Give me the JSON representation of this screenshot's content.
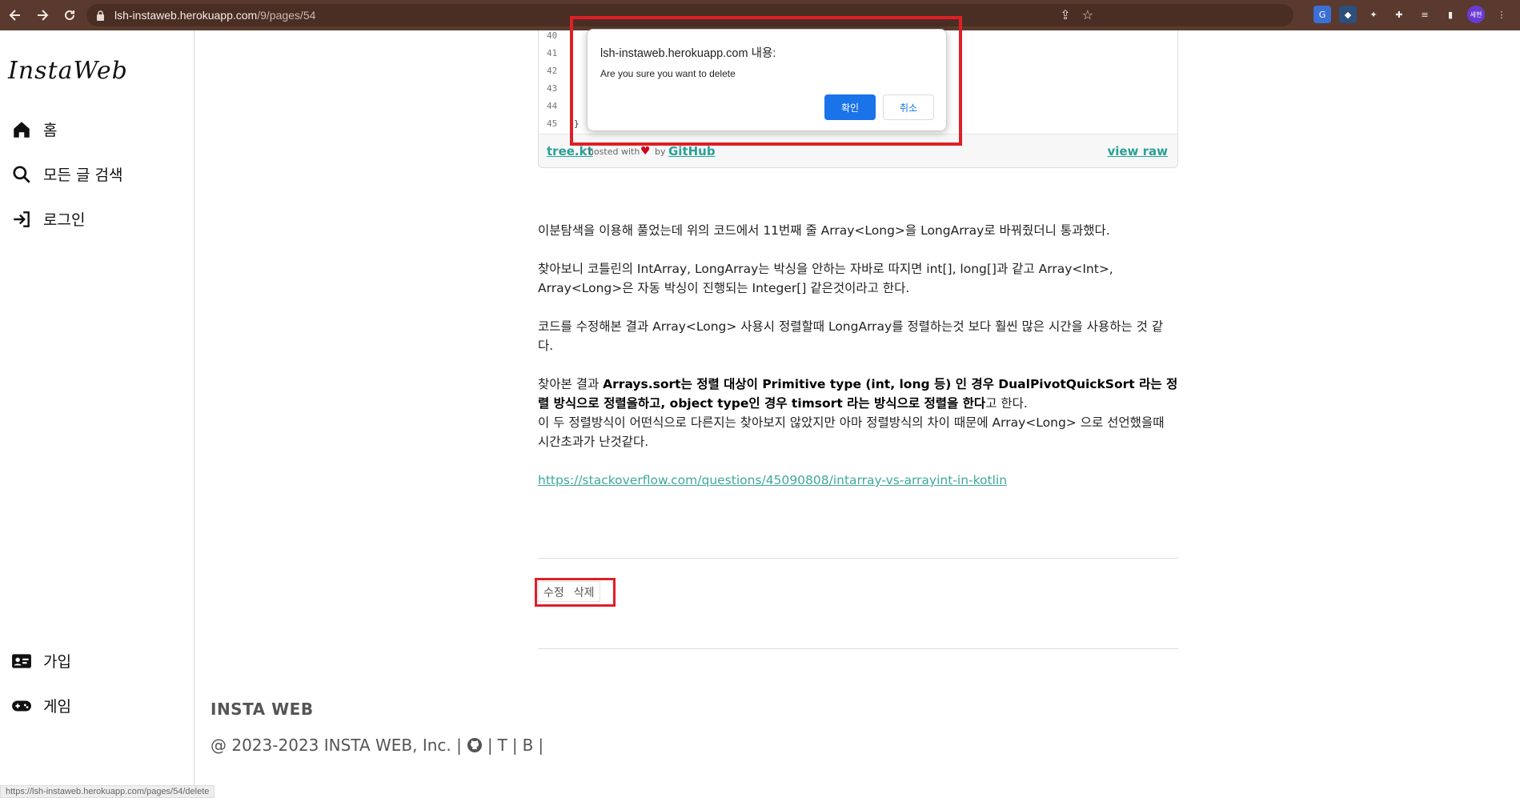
{
  "browser": {
    "url_host": "lsh-instaweb.herokuapp.com",
    "url_path": "/9/pages/54",
    "profile_label": "세현"
  },
  "sidebar": {
    "logo": "InstaWeb",
    "items": [
      {
        "label": "홈",
        "icon": "home-icon"
      },
      {
        "label": "모든 글 검색",
        "icon": "search-icon"
      },
      {
        "label": "로그인",
        "icon": "login-icon"
      },
      {
        "label": "가입",
        "icon": "id-card-icon"
      },
      {
        "label": "게임",
        "icon": "gamepad-icon"
      }
    ]
  },
  "gist": {
    "line_numbers": [
      "40",
      "41",
      "42",
      "43",
      "44",
      "45"
    ],
    "closing_brace": "}",
    "file_name": "tree.kt",
    "hosted_with": "hosted with",
    "by": "by",
    "github": "GitHub",
    "view_raw": "view raw"
  },
  "article": {
    "p1": "이분탐색을 이용해 풀었는데 위의 코드에서 11번째 줄  Array<Long>을 LongArray로 바꿔줬더니 통과했다.",
    "p2": "찾아보니 코틀린의 IntArray, LongArray는 박싱을 안하는 자바로 따지면 int[], long[]과 같고 Array<Int>, Array<Long>은 자동 박싱이 진행되는 Integer[] 같은것이라고 한다.",
    "p3": "코드를 수정해본 결과 Array<Long> 사용시 정렬할때 LongArray를 정렬하는것 보다 훨씬 많은 시간을 사용하는 것 같다.",
    "p4_prefix": "찾아본 결과 ",
    "p4_bold": "Arrays.sort는 정렬 대상이 Primitive type (int, long 등) 인 경우 DualPivotQuickSort 라는 정렬 방식으로 정렬을하고, object type인 경우 timsort 라는 방식으로 정렬을 한다",
    "p4_suffix": "고 한다.",
    "p4_line2": "이 두 정렬방식이 어떤식으로 다른지는 찾아보지 않았지만 아마 정렬방식의 차이 때문에 Array<Long> 으로 선언했을때 시간초과가 난것같다.",
    "link": "https://stackoverflow.com/questions/45090808/intarray-vs-arrayint-in-kotlin"
  },
  "actions": {
    "edit": "수정",
    "delete": "삭제"
  },
  "footer": {
    "title": "INSTA WEB",
    "copyright": "@ 2023-2023 INSTA WEB, Inc. |",
    "sep1": "|",
    "t": "T",
    "sep2": "|",
    "b": "B",
    "sep3": "|"
  },
  "status_bar": {
    "url": "https://lsh-instaweb.herokuapp.com/pages/54/delete"
  },
  "dialog": {
    "title": "lsh-instaweb.herokuapp.com 내용:",
    "message": "Are you sure you want to delete",
    "ok": "확인",
    "cancel": "취소"
  },
  "colors": {
    "chrome": "#5a3a2e",
    "accent": "#1a73e8",
    "link": "#3fa89c",
    "highlight": "#e01e26"
  }
}
